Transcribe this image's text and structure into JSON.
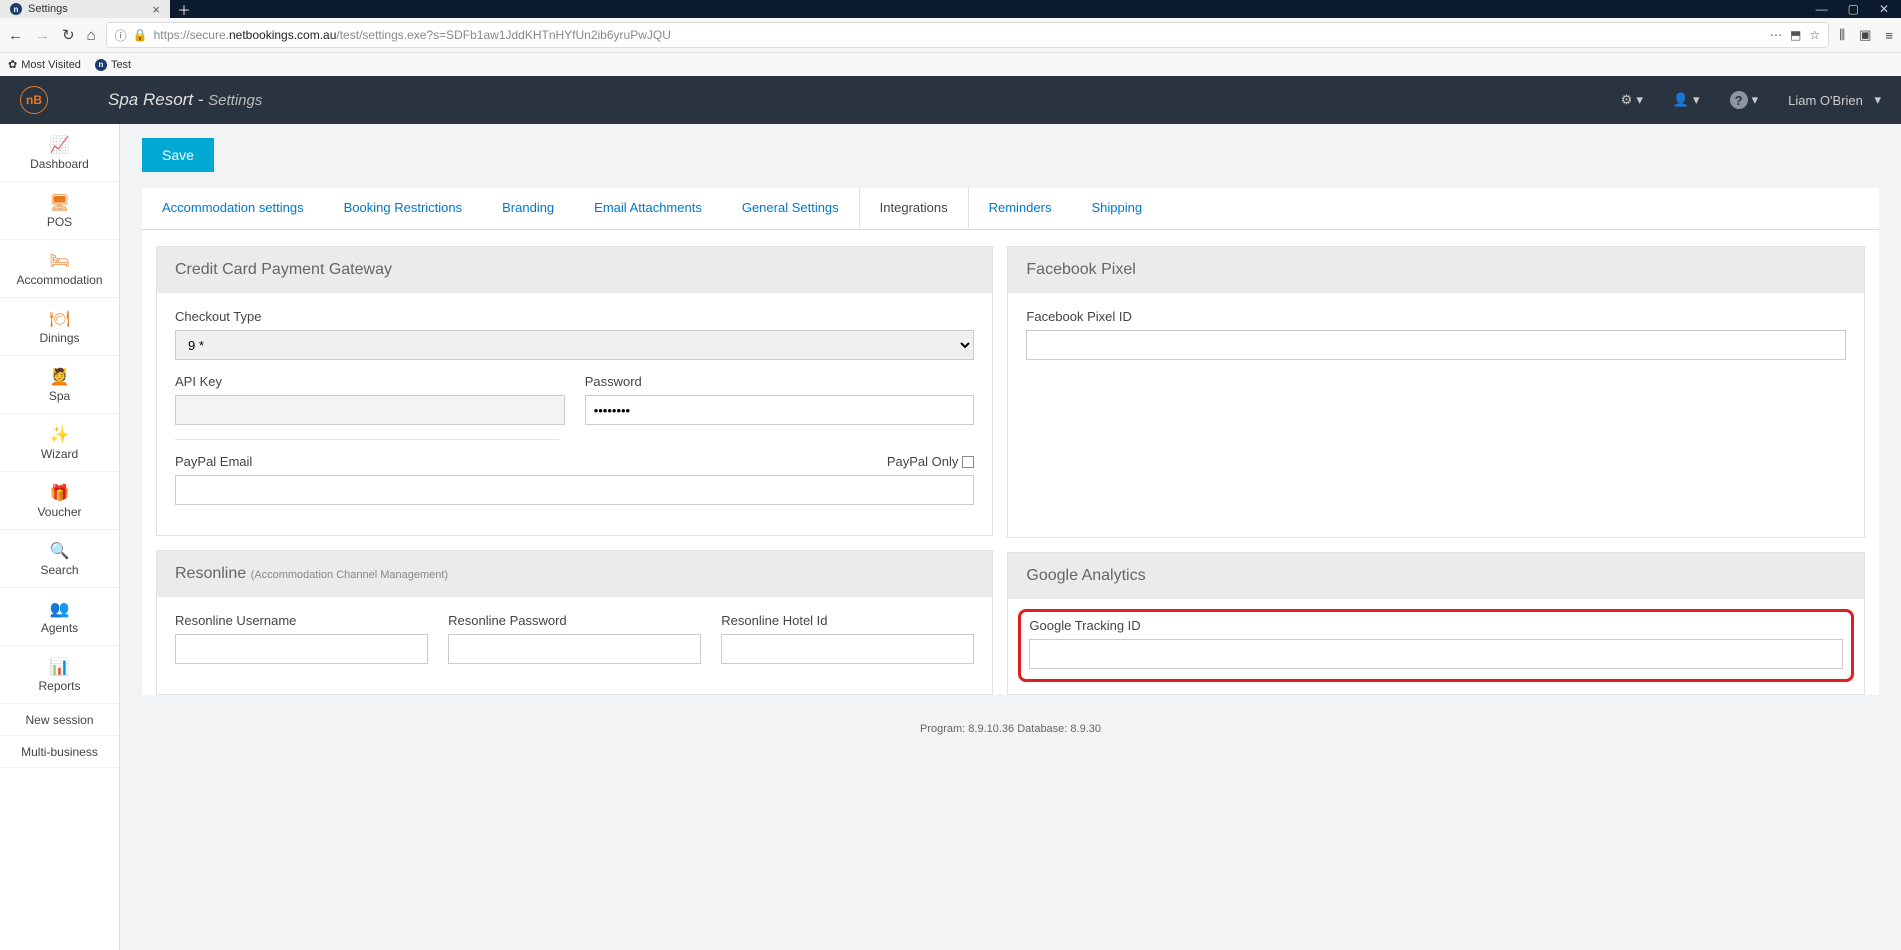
{
  "browser": {
    "tab_title": "Settings",
    "url_prefix": "https://secure.",
    "url_domain": "netbookings.com.au",
    "url_path": "/test/settings.exe?s=SDFb1aw1JddKHTnHYfUn2ib6yruPwJQU",
    "bookmarks": [
      "Most Visited",
      "Test"
    ]
  },
  "app": {
    "logo_text": "nB",
    "title_main": "Spa Resort",
    "title_sep": " - ",
    "title_sub": "Settings",
    "user_name": "Liam O'Brien"
  },
  "sidebar": {
    "items": [
      {
        "label": "Dashboard"
      },
      {
        "label": "POS"
      },
      {
        "label": "Accommodation"
      },
      {
        "label": "Dinings"
      },
      {
        "label": "Spa"
      },
      {
        "label": "Wizard"
      },
      {
        "label": "Voucher"
      },
      {
        "label": "Search"
      },
      {
        "label": "Agents"
      },
      {
        "label": "Reports"
      }
    ],
    "footer_items": [
      "New session",
      "Multi-business"
    ]
  },
  "save_label": "Save",
  "tabs": [
    {
      "label": "Accommodation settings"
    },
    {
      "label": "Booking Restrictions"
    },
    {
      "label": "Branding"
    },
    {
      "label": "Email Attachments"
    },
    {
      "label": "General Settings"
    },
    {
      "label": "Integrations",
      "active": true
    },
    {
      "label": "Reminders"
    },
    {
      "label": "Shipping"
    }
  ],
  "panels": {
    "ccgateway": {
      "title": "Credit Card Payment Gateway",
      "checkout_type_label": "Checkout Type",
      "checkout_type_value": "9 *",
      "api_key_label": "API Key",
      "api_key_value": "",
      "password_label": "Password",
      "password_value": "••••••••",
      "paypal_email_label": "PayPal Email",
      "paypal_only_label": "PayPal Only"
    },
    "fbpixel": {
      "title": "Facebook Pixel",
      "id_label": "Facebook Pixel ID"
    },
    "resonline": {
      "title": "Resonline",
      "subtitle": "(Accommodation Channel Management)",
      "username_label": "Resonline Username",
      "password_label": "Resonline Password",
      "hotel_id_label": "Resonline Hotel Id"
    },
    "ganalytics": {
      "title": "Google Analytics",
      "tracking_id_label": "Google Tracking ID"
    }
  },
  "footer": "Program: 8.9.10.36 Database: 8.9.30"
}
